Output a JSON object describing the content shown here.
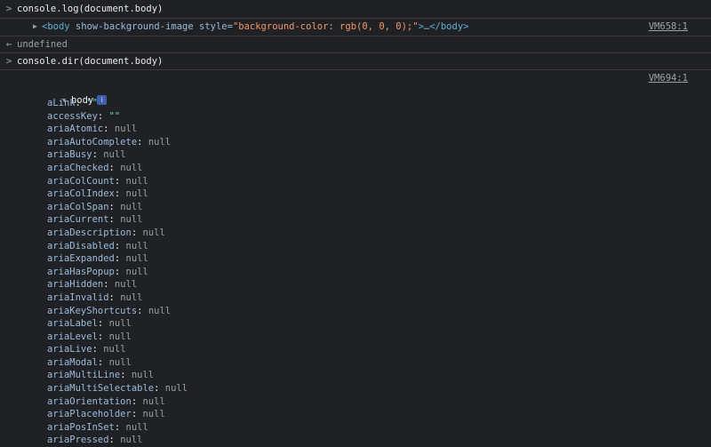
{
  "console": {
    "row1": {
      "prefix": ">",
      "code_before": "console.",
      "code_method": "log",
      "code_after": "(document.body)"
    },
    "row2": {
      "tag_open": "<body",
      "attr1": " show-background-image",
      "attr2_name": " style=",
      "attr2_value": "\"background-color: rgb(0, 0, 0);\"",
      "tag_close": ">…</body>",
      "source": "VM658:1"
    },
    "row3": {
      "prefix": "←",
      "text": "undefined"
    },
    "row4": {
      "prefix": ">",
      "code_before": "console.",
      "code_method": "dir",
      "code_after": "(document.body)"
    },
    "row5": {
      "source": "VM694:1",
      "object_label": "body",
      "info_badge": "i"
    }
  },
  "properties": [
    {
      "key": "aLink",
      "value": "\"\"",
      "kind": "str"
    },
    {
      "key": "accessKey",
      "value": "\"\"",
      "kind": "str"
    },
    {
      "key": "ariaAtomic",
      "value": "null",
      "kind": "null"
    },
    {
      "key": "ariaAutoComplete",
      "value": "null",
      "kind": "null"
    },
    {
      "key": "ariaBusy",
      "value": "null",
      "kind": "null"
    },
    {
      "key": "ariaChecked",
      "value": "null",
      "kind": "null"
    },
    {
      "key": "ariaColCount",
      "value": "null",
      "kind": "null"
    },
    {
      "key": "ariaColIndex",
      "value": "null",
      "kind": "null"
    },
    {
      "key": "ariaColSpan",
      "value": "null",
      "kind": "null"
    },
    {
      "key": "ariaCurrent",
      "value": "null",
      "kind": "null"
    },
    {
      "key": "ariaDescription",
      "value": "null",
      "kind": "null"
    },
    {
      "key": "ariaDisabled",
      "value": "null",
      "kind": "null"
    },
    {
      "key": "ariaExpanded",
      "value": "null",
      "kind": "null"
    },
    {
      "key": "ariaHasPopup",
      "value": "null",
      "kind": "null"
    },
    {
      "key": "ariaHidden",
      "value": "null",
      "kind": "null"
    },
    {
      "key": "ariaInvalid",
      "value": "null",
      "kind": "null"
    },
    {
      "key": "ariaKeyShortcuts",
      "value": "null",
      "kind": "null"
    },
    {
      "key": "ariaLabel",
      "value": "null",
      "kind": "null"
    },
    {
      "key": "ariaLevel",
      "value": "null",
      "kind": "null"
    },
    {
      "key": "ariaLive",
      "value": "null",
      "kind": "null"
    },
    {
      "key": "ariaModal",
      "value": "null",
      "kind": "null"
    },
    {
      "key": "ariaMultiLine",
      "value": "null",
      "kind": "null"
    },
    {
      "key": "ariaMultiSelectable",
      "value": "null",
      "kind": "null"
    },
    {
      "key": "ariaOrientation",
      "value": "null",
      "kind": "null"
    },
    {
      "key": "ariaPlaceholder",
      "value": "null",
      "kind": "null"
    },
    {
      "key": "ariaPosInSet",
      "value": "null",
      "kind": "null"
    },
    {
      "key": "ariaPressed",
      "value": "null",
      "kind": "null"
    }
  ],
  "colors": {
    "background": "#202124",
    "tag": "#5db0d7",
    "attr_value": "#f29766",
    "key": "#9bbbdc",
    "string": "#6bd2c6",
    "muted": "#9aa0a6"
  }
}
